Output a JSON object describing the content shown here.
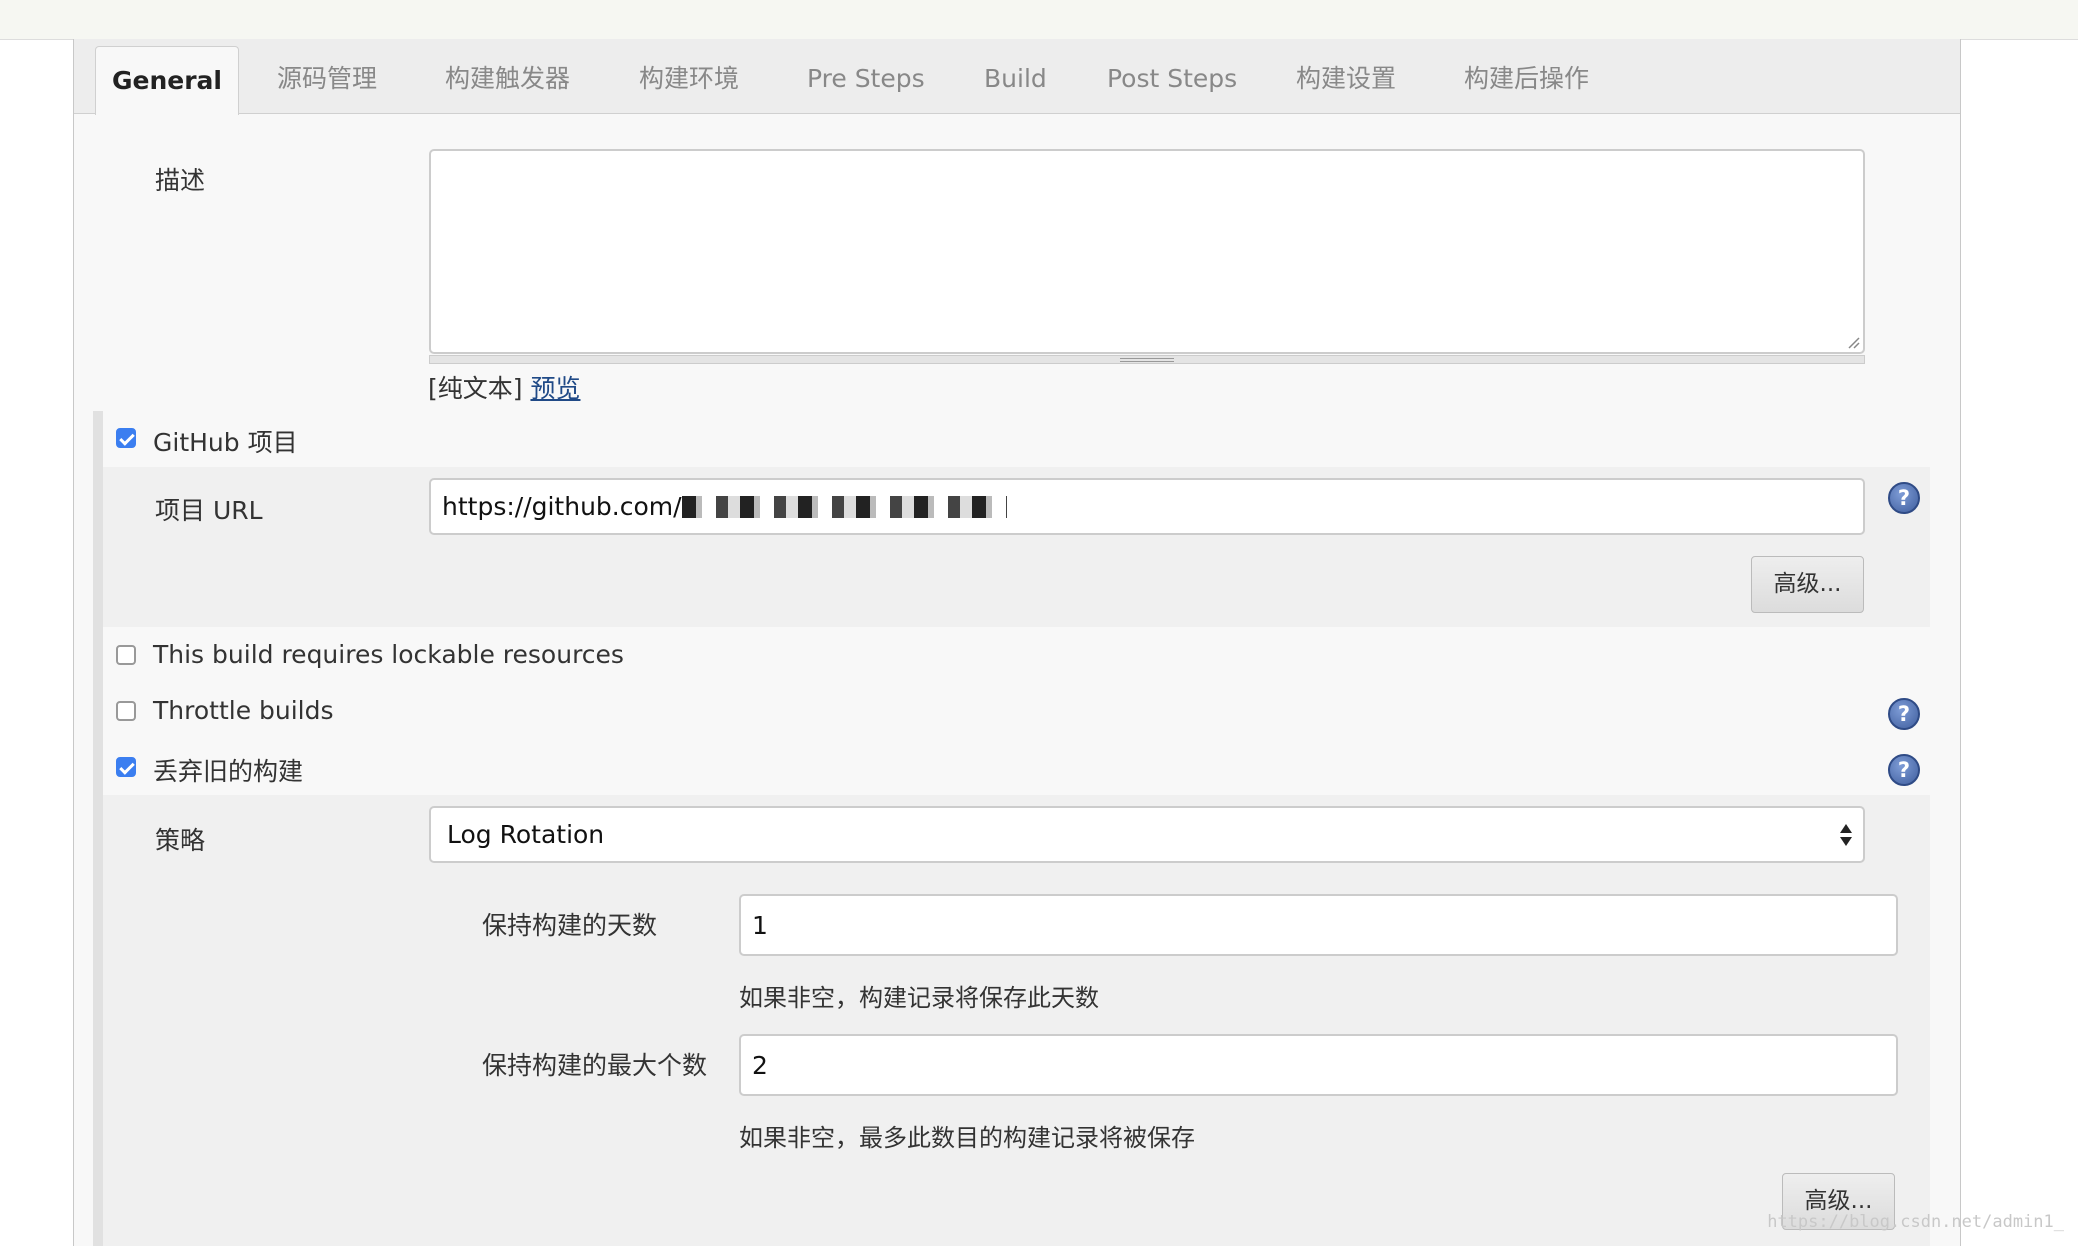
{
  "tabs": [
    {
      "label": "General",
      "active": true
    },
    {
      "label": "源码管理"
    },
    {
      "label": "构建触发器"
    },
    {
      "label": "构建环境"
    },
    {
      "label": "Pre Steps"
    },
    {
      "label": "Build"
    },
    {
      "label": "Post Steps"
    },
    {
      "label": "构建设置"
    },
    {
      "label": "构建后操作"
    }
  ],
  "description": {
    "label": "描述",
    "value": "",
    "format_text": "[纯文本]",
    "preview_link": "预览"
  },
  "github": {
    "checkbox_label": "GitHub 项目",
    "checked": true,
    "url_label": "项目 URL",
    "url_value": "https://github.com/",
    "advanced_button": "高级..."
  },
  "lockable": {
    "label": "This build requires lockable resources",
    "checked": false
  },
  "throttle": {
    "label": "Throttle builds",
    "checked": false
  },
  "discard": {
    "label": "丢弃旧的构建",
    "checked": true,
    "strategy_label": "策略",
    "strategy_value": "Log Rotation",
    "days_label": "保持构建的天数",
    "days_value": "1",
    "days_hint": "如果非空，构建记录将保存此天数",
    "max_label": "保持构建的最大个数",
    "max_value": "2",
    "max_hint": "如果非空，最多此数目的构建记录将被保存",
    "advanced_button": "高级..."
  },
  "help_icon_text": "?",
  "watermark": "https://blog.csdn.net/admin1_",
  "colors": {
    "checkbox_accent": "#3b7ef0",
    "link": "#204a87",
    "help": "#3f5e9e"
  }
}
